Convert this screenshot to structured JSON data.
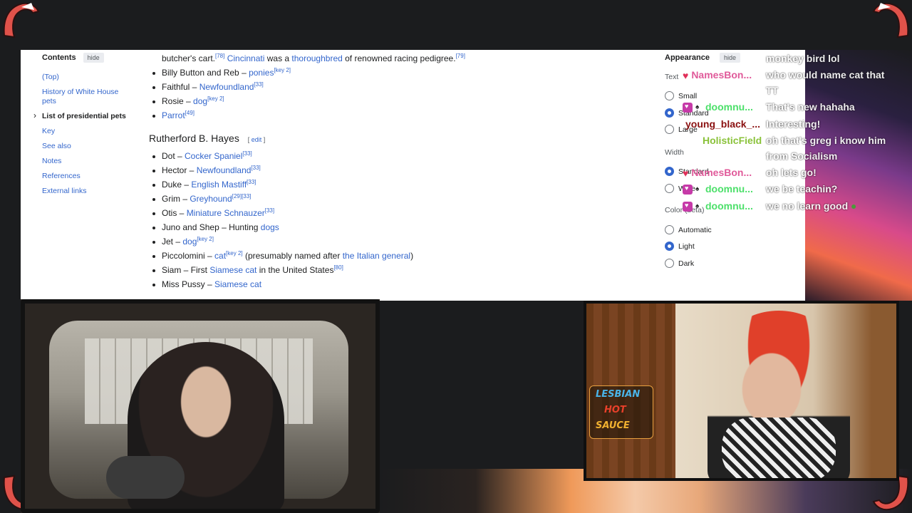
{
  "wiki": {
    "toc": {
      "title": "Contents",
      "hide": "hide",
      "items": [
        {
          "label": "(Top)"
        },
        {
          "label": "History of White House pets"
        },
        {
          "label": "List of presidential pets"
        },
        {
          "label": "Key"
        },
        {
          "label": "See also"
        },
        {
          "label": "Notes"
        },
        {
          "label": "References"
        },
        {
          "label": "External links"
        }
      ]
    },
    "top_lines": {
      "line0": {
        "pre": "butcher's cart.",
        "ref1": "[78]",
        "link1": "Cincinnati",
        "mid": " was a ",
        "link2": "thoroughbred",
        "post": " of renowned racing pedigree.",
        "ref2": "[79]"
      },
      "line1": {
        "pre": "Billy Button and Reb – ",
        "link": "ponies",
        "ref": "[key 2]"
      },
      "line2": {
        "pre": "Faithful – ",
        "link": "Newfoundland",
        "ref": "[33]"
      },
      "line3": {
        "pre": "Rosie – ",
        "link": "dog",
        "ref": "[key 2]"
      },
      "line4": {
        "pre": "",
        "link": "Parrot",
        "ref": "[49]"
      }
    },
    "heading": "Rutherford B. Hayes",
    "edit": "edit",
    "hayes": {
      "l1": {
        "pre": "Dot – ",
        "link": "Cocker Spaniel",
        "ref": "[33]"
      },
      "l2": {
        "pre": "Hector – ",
        "link": "Newfoundland",
        "ref": "[33]"
      },
      "l3": {
        "pre": "Duke – ",
        "link": "English Mastiff",
        "ref": "[33]"
      },
      "l4": {
        "pre": "Grim – ",
        "link": "Greyhound",
        "ref": "[29][33]"
      },
      "l5": {
        "pre": "Otis – ",
        "link": "Miniature Schnauzer",
        "ref": "[33]"
      },
      "l6": {
        "pre": "Juno and Shep – Hunting ",
        "link": "dogs",
        "ref": ""
      },
      "l7": {
        "pre": "Jet – ",
        "link": "dog",
        "ref": "[key 2]"
      },
      "l8": {
        "pre": "Piccolomini – ",
        "link": "cat",
        "ref": "[key 2]",
        "mid": " (presumably named after ",
        "link2": "the Italian general",
        "post": ")"
      },
      "l9": {
        "pre": "Siam – First ",
        "link": "Siamese cat",
        "post": " in the United States",
        "ref": "[80]"
      },
      "l10": {
        "pre": "Miss Pussy – ",
        "link": "Siamese cat",
        "ref": ""
      }
    },
    "appearance": {
      "title": "Appearance",
      "hide": "hide",
      "text_label": "Text",
      "text_options": [
        "Small",
        "Standard",
        "Large"
      ],
      "width_label": "Width",
      "width_options": [
        "Standard",
        "Wide"
      ],
      "color_label": "Color (beta)",
      "color_options": [
        "Automatic",
        "Light",
        "Dark"
      ]
    }
  },
  "chat": {
    "messages": [
      {
        "name": "",
        "text": "monkey bird lol"
      },
      {
        "name": "NamesBon...",
        "text": "who would name cat that"
      },
      {
        "name": "",
        "text": "TT"
      },
      {
        "name": "doomnu...",
        "text": "That's new hahaha"
      },
      {
        "name": "young_black_...",
        "text": "Interesting!"
      },
      {
        "name": "HolisticField",
        "text": "oh that's greg i know him"
      },
      {
        "name": "",
        "text": "from Socialism"
      },
      {
        "name": "NamesBon...",
        "text": "oh lets go!"
      },
      {
        "name": "doomnu...",
        "text": "we be teachin?"
      },
      {
        "name": "doomnu...",
        "text": "we no learn good"
      }
    ]
  },
  "cam2": {
    "sign": [
      "LESBIAN",
      "HOT",
      "SAUCE"
    ]
  },
  "colors": {
    "link": "#3366cc",
    "chat_pink": "#e05a9a",
    "chat_green": "#4ce06a",
    "chat_red": "#8a1010",
    "chat_lime": "#8ac23a",
    "claw": "#e0524a"
  }
}
